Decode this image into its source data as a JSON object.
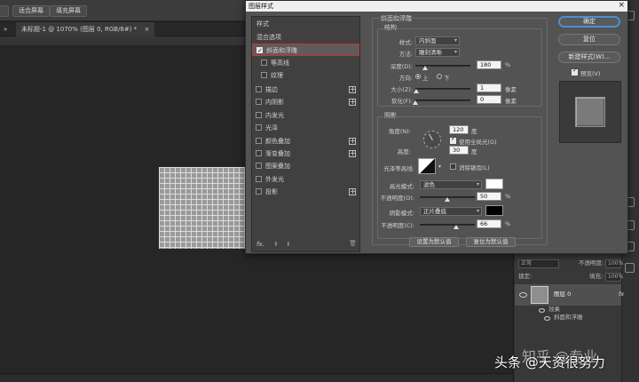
{
  "toolbar": {
    "fit_screen": "适合屏幕",
    "fill_screen": "填充屏幕"
  },
  "tabs": {
    "left_fragment": "» ",
    "document": "未标题-1 @ 1070% (图层 0, RGB/8#) *",
    "close": "×"
  },
  "dialog": {
    "title": "图层样式",
    "close": "×",
    "styles": {
      "header": "样式",
      "blend_options": "混合选项",
      "items": [
        {
          "label": "斜面和浮雕",
          "checked": true,
          "plus": false
        },
        {
          "label": "等高线",
          "checked": false,
          "plus": false
        },
        {
          "label": "纹理",
          "checked": false,
          "plus": false
        },
        {
          "label": "描边",
          "checked": false,
          "plus": true
        },
        {
          "label": "内阴影",
          "checked": false,
          "plus": true
        },
        {
          "label": "内发光",
          "checked": false,
          "plus": false
        },
        {
          "label": "光泽",
          "checked": false,
          "plus": false
        },
        {
          "label": "颜色叠加",
          "checked": false,
          "plus": true
        },
        {
          "label": "渐变叠加",
          "checked": false,
          "plus": true
        },
        {
          "label": "图案叠加",
          "checked": false,
          "plus": false
        },
        {
          "label": "外发光",
          "checked": false,
          "plus": false
        },
        {
          "label": "投影",
          "checked": false,
          "plus": true
        }
      ],
      "footer_fx": "fx.",
      "footer_up": "⬆",
      "footer_down": "⬇",
      "footer_trash": "🗑"
    },
    "bevel": {
      "title": "斜面和浮雕",
      "structure_title": "结构",
      "style_label": "样式:",
      "style_value": "内斜面",
      "technique_label": "方法:",
      "technique_value": "雕刻清晰",
      "depth_label": "深度(D):",
      "depth_value": "180",
      "depth_unit": "%",
      "depth_fraction": 0.18,
      "direction_label": "方向:",
      "dir_up": "上",
      "dir_down": "下",
      "size_label": "大小(Z):",
      "size_value": "1",
      "size_unit": "像素",
      "size_fraction": 0.01,
      "soften_label": "软化(F):",
      "soften_value": "0",
      "soften_unit": "像素",
      "soften_fraction": 0.0
    },
    "shading": {
      "title": "阴影",
      "angle_label": "角度(N):",
      "angle_value": "120",
      "angle_unit": "度",
      "global_light_label": "使用全局光(G)",
      "altitude_label": "高度:",
      "altitude_value": "30",
      "altitude_unit": "度",
      "gloss_contour_label": "光泽等高线:",
      "anti_alias_label": "消除锯齿(L)",
      "highlight_mode_label": "高光模式:",
      "highlight_mode_value": "滤色",
      "highlight_color": "#ffffff",
      "highlight_opacity_label": "不透明度(O):",
      "highlight_opacity_value": "50",
      "highlight_opacity_unit": "%",
      "highlight_opacity_fraction": 0.5,
      "shadow_mode_label": "阴影模式:",
      "shadow_mode_value": "正片叠底",
      "shadow_color": "#000000",
      "shadow_opacity_label": "不透明度(C):",
      "shadow_opacity_value": "66",
      "shadow_opacity_unit": "%",
      "shadow_opacity_fraction": 0.66
    },
    "set_default": "设置为默认值",
    "reset_default": "复位为默认值",
    "buttons": {
      "ok": "确定",
      "reset": "复位",
      "new_style": "新建样式(W)...",
      "preview_label": "预览(V)"
    }
  },
  "layers": {
    "blend_mode": "正常",
    "opacity_label": "不透明度:",
    "opacity_value": "100%",
    "lock_label": "锁定:",
    "fill_label": "填充:",
    "fill_value": "100%",
    "layer_name": "图层 0",
    "fx_badge": "fx",
    "effects_label": "效果",
    "bevel_effect": "斜面和浮雕"
  },
  "watermark": {
    "zhihu": "知乎 @专业",
    "toutiao": "头条 @天资很努力"
  }
}
